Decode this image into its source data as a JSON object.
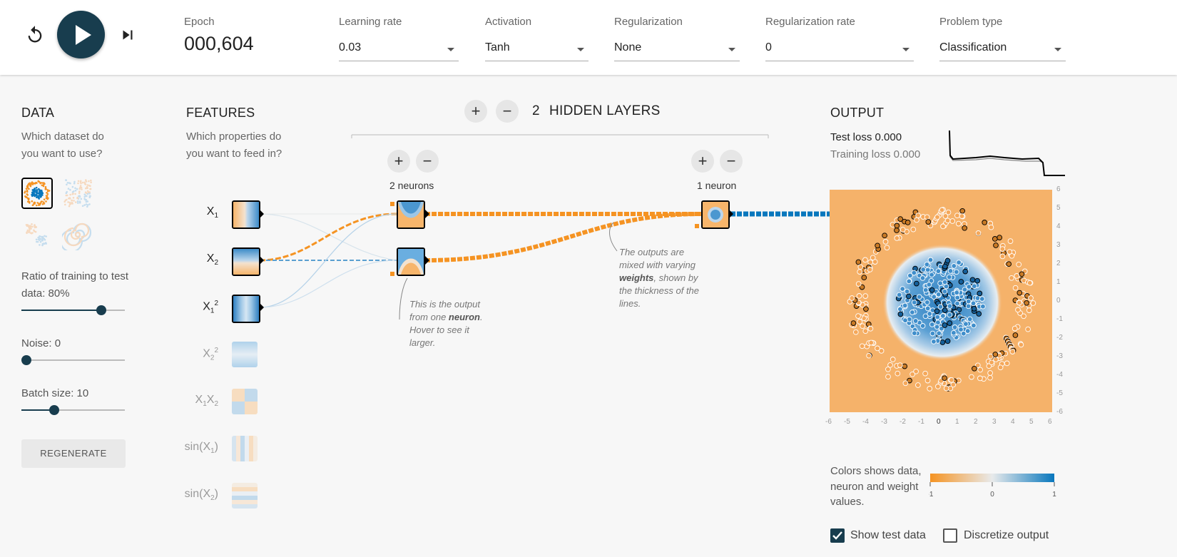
{
  "controls": {
    "reset_icon": "reset-icon",
    "play_icon": "play-icon",
    "step_icon": "step-forward-icon",
    "epoch_label": "Epoch",
    "epoch_value": "000,604",
    "learning_rate_label": "Learning rate",
    "learning_rate_value": "0.03",
    "activation_label": "Activation",
    "activation_value": "Tanh",
    "regularization_label": "Regularization",
    "regularization_value": "None",
    "reg_rate_label": "Regularization rate",
    "reg_rate_value": "0",
    "problem_type_label": "Problem type",
    "problem_type_value": "Classification"
  },
  "data_panel": {
    "title": "DATA",
    "question": "Which dataset do you want to use?",
    "datasets": [
      "circle",
      "xor",
      "gaussian",
      "spiral"
    ],
    "selected_dataset": "circle",
    "ratio_label": "Ratio of training to test data:",
    "ratio_value": "80%",
    "ratio_level": 0.8,
    "noise_label": "Noise:",
    "noise_value": "0",
    "noise_level": 0,
    "batch_label": "Batch size:",
    "batch_value": "10",
    "batch_level": 0.3,
    "regenerate_label": "REGENERATE"
  },
  "features_panel": {
    "title": "FEATURES",
    "question": "Which properties do you want to feed in?",
    "features": [
      {
        "base": "X",
        "sub": "1",
        "sup": "",
        "active": true
      },
      {
        "base": "X",
        "sub": "2",
        "sup": "",
        "active": true
      },
      {
        "base": "X",
        "sub": "1",
        "sup": "2",
        "active": true
      },
      {
        "base": "X",
        "sub": "2",
        "sup": "2",
        "active": false
      },
      {
        "base": "X",
        "sub": "1",
        "base2": "X",
        "sub2": "2",
        "active": false
      },
      {
        "base": "sin(X",
        "sub": "1",
        "tail": ")",
        "active": false
      },
      {
        "base": "sin(X",
        "sub": "2",
        "tail": ")",
        "active": false
      }
    ]
  },
  "network": {
    "add_layer_symbol": "+",
    "remove_layer_symbol": "−",
    "layer_count": "2",
    "hidden_layers_label": "HIDDEN LAYERS",
    "layers": [
      {
        "neurons_label": "2 neurons",
        "add_symbol": "+",
        "remove_symbol": "−"
      },
      {
        "neurons_label": "1 neuron",
        "add_symbol": "+",
        "remove_symbol": "−"
      }
    ],
    "note1": {
      "pre": "This is the output from one ",
      "bold": "neuron",
      "post": ". Hover to see it larger."
    },
    "note2": {
      "pre": "The outputs are mixed with varying ",
      "bold": "weights",
      "post": ", shown by the thickness of the lines."
    }
  },
  "output_panel": {
    "title": "OUTPUT",
    "test_loss_label": "Test loss",
    "test_loss_value": "0.000",
    "training_loss_label": "Training loss",
    "training_loss_value": "0.000",
    "x_ticks": [
      "-6",
      "-5",
      "-4",
      "-3",
      "-2",
      "-1",
      "0",
      "1",
      "2",
      "3",
      "4",
      "5",
      "6"
    ],
    "y_ticks": [
      "6",
      "5",
      "4",
      "3",
      "2",
      "1",
      "0",
      "-1",
      "-2",
      "-3",
      "-4",
      "-5",
      "-6"
    ],
    "legend_text": "Colors shows data, neuron and weight values.",
    "scale_labels": [
      "-1",
      "0",
      "1"
    ],
    "show_test_label": "Show test data",
    "show_test_checked": true,
    "discretize_label": "Discretize output",
    "discretize_checked": false
  },
  "colors": {
    "orange": "#f59322",
    "blue": "#0877bd",
    "light_orange": "#f7b56b",
    "light_blue": "#9cc6e6",
    "dark_button": "#183d4e"
  }
}
